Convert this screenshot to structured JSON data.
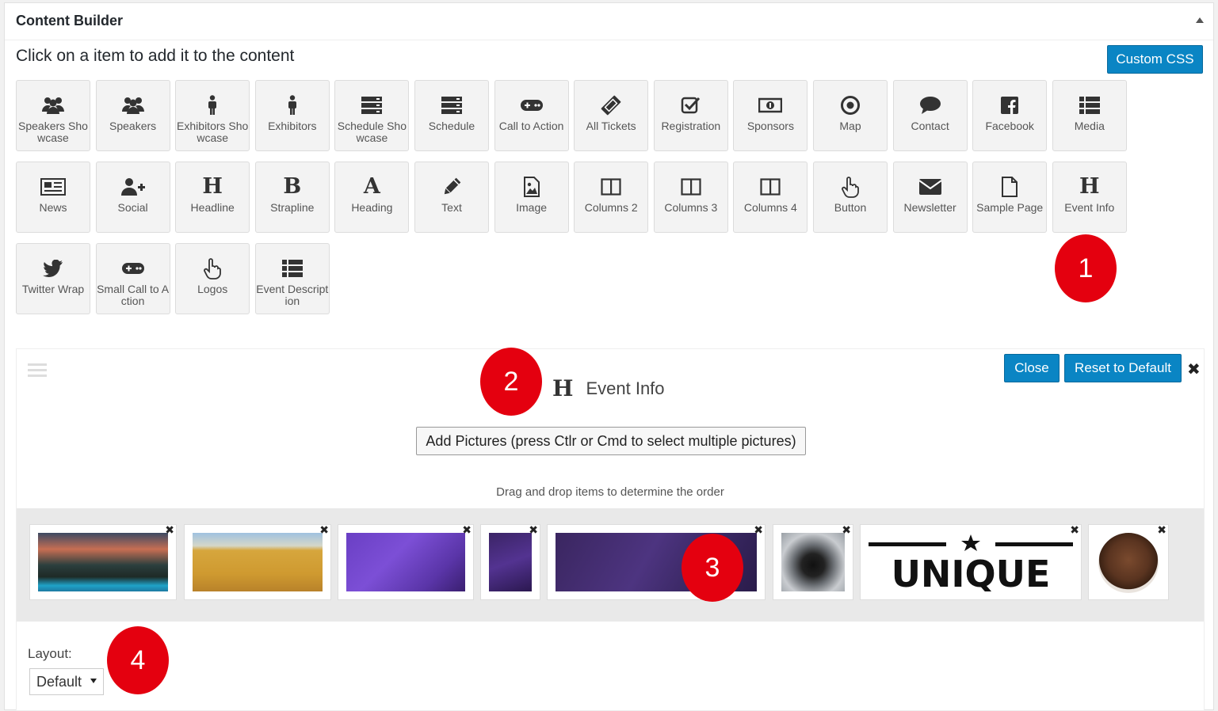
{
  "panel": {
    "title": "Content Builder"
  },
  "instructions": "Click on a item to add it to the content",
  "custom_css_label": "Custom CSS",
  "tiles": [
    {
      "label": "Speakers Showcase",
      "icon": "users-icon"
    },
    {
      "label": "Speakers",
      "icon": "users-icon"
    },
    {
      "label": "Exhibitors Showcase",
      "icon": "person-icon"
    },
    {
      "label": "Exhibitors",
      "icon": "person-icon"
    },
    {
      "label": "Schedule Showcase",
      "icon": "server-icon"
    },
    {
      "label": "Schedule",
      "icon": "server-icon"
    },
    {
      "label": "Call to Action",
      "icon": "gamepad-icon"
    },
    {
      "label": "All Tickets",
      "icon": "ticket-icon"
    },
    {
      "label": "Registration",
      "icon": "check-square-icon"
    },
    {
      "label": "Sponsors",
      "icon": "money-icon"
    },
    {
      "label": "Map",
      "icon": "target-icon"
    },
    {
      "label": "Contact",
      "icon": "comment-icon"
    },
    {
      "label": "Facebook",
      "icon": "facebook-icon"
    },
    {
      "label": "Media",
      "icon": "list-icon"
    },
    {
      "label": "News",
      "icon": "newspaper-icon"
    },
    {
      "label": "Social",
      "icon": "user-plus-icon"
    },
    {
      "label": "Headline",
      "icon": "header-icon",
      "glyph": "H"
    },
    {
      "label": "Strapline",
      "icon": "bold-icon",
      "glyph": "B"
    },
    {
      "label": "Heading",
      "icon": "font-icon",
      "glyph": "A"
    },
    {
      "label": "Text",
      "icon": "pencil-icon"
    },
    {
      "label": "Image",
      "icon": "image-icon"
    },
    {
      "label": "Columns 2",
      "icon": "columns-icon"
    },
    {
      "label": "Columns 3",
      "icon": "columns-icon"
    },
    {
      "label": "Columns 4",
      "icon": "columns-icon"
    },
    {
      "label": "Button",
      "icon": "hand-pointer-icon"
    },
    {
      "label": "Newsletter",
      "icon": "envelope-icon"
    },
    {
      "label": "Sample Page",
      "icon": "file-icon"
    },
    {
      "label": "Event Info",
      "icon": "header-icon",
      "glyph": "H"
    },
    {
      "label": "Twitter Wrap",
      "icon": "twitter-icon"
    },
    {
      "label": "Small Call to Action",
      "icon": "gamepad-icon"
    },
    {
      "label": "Logos",
      "icon": "hand-pointer-icon"
    },
    {
      "label": "Event Description",
      "icon": "list-icon"
    }
  ],
  "badges": [
    "1",
    "2",
    "3",
    "4"
  ],
  "editor": {
    "close_label": "Close",
    "reset_label": "Reset to Default",
    "remove_symbol": "✖",
    "title_glyph": "H",
    "title": "Event Info",
    "add_pictures_label": "Add Pictures (press Ctlr or Cmd to select multiple pictures)",
    "drag_hint": "Drag and drop items to determine the order",
    "layout_label": "Layout:",
    "layout_value": "Default"
  },
  "thumb_remove_symbol": "✖",
  "unique_logo_text": "UNIQUE"
}
